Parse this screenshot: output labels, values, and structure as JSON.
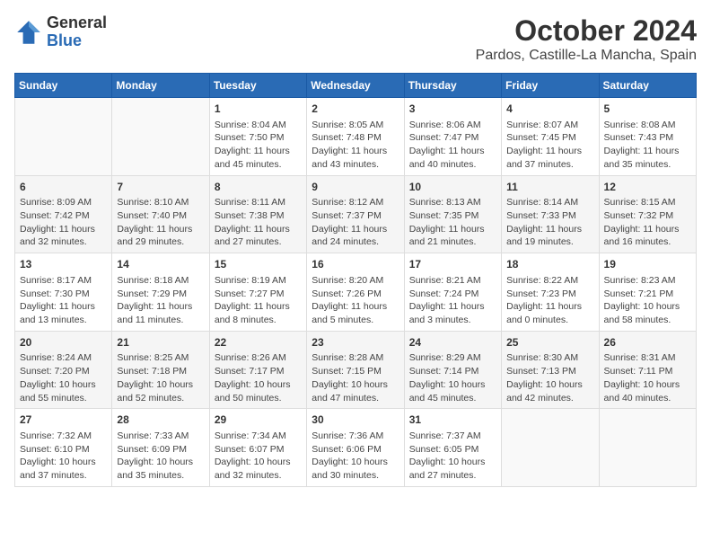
{
  "logo": {
    "general": "General",
    "blue": "Blue"
  },
  "title": "October 2024",
  "subtitle": "Pardos, Castille-La Mancha, Spain",
  "days_of_week": [
    "Sunday",
    "Monday",
    "Tuesday",
    "Wednesday",
    "Thursday",
    "Friday",
    "Saturday"
  ],
  "weeks": [
    [
      {
        "day": "",
        "info": ""
      },
      {
        "day": "",
        "info": ""
      },
      {
        "day": "1",
        "info": "Sunrise: 8:04 AM\nSunset: 7:50 PM\nDaylight: 11 hours and 45 minutes."
      },
      {
        "day": "2",
        "info": "Sunrise: 8:05 AM\nSunset: 7:48 PM\nDaylight: 11 hours and 43 minutes."
      },
      {
        "day": "3",
        "info": "Sunrise: 8:06 AM\nSunset: 7:47 PM\nDaylight: 11 hours and 40 minutes."
      },
      {
        "day": "4",
        "info": "Sunrise: 8:07 AM\nSunset: 7:45 PM\nDaylight: 11 hours and 37 minutes."
      },
      {
        "day": "5",
        "info": "Sunrise: 8:08 AM\nSunset: 7:43 PM\nDaylight: 11 hours and 35 minutes."
      }
    ],
    [
      {
        "day": "6",
        "info": "Sunrise: 8:09 AM\nSunset: 7:42 PM\nDaylight: 11 hours and 32 minutes."
      },
      {
        "day": "7",
        "info": "Sunrise: 8:10 AM\nSunset: 7:40 PM\nDaylight: 11 hours and 29 minutes."
      },
      {
        "day": "8",
        "info": "Sunrise: 8:11 AM\nSunset: 7:38 PM\nDaylight: 11 hours and 27 minutes."
      },
      {
        "day": "9",
        "info": "Sunrise: 8:12 AM\nSunset: 7:37 PM\nDaylight: 11 hours and 24 minutes."
      },
      {
        "day": "10",
        "info": "Sunrise: 8:13 AM\nSunset: 7:35 PM\nDaylight: 11 hours and 21 minutes."
      },
      {
        "day": "11",
        "info": "Sunrise: 8:14 AM\nSunset: 7:33 PM\nDaylight: 11 hours and 19 minutes."
      },
      {
        "day": "12",
        "info": "Sunrise: 8:15 AM\nSunset: 7:32 PM\nDaylight: 11 hours and 16 minutes."
      }
    ],
    [
      {
        "day": "13",
        "info": "Sunrise: 8:17 AM\nSunset: 7:30 PM\nDaylight: 11 hours and 13 minutes."
      },
      {
        "day": "14",
        "info": "Sunrise: 8:18 AM\nSunset: 7:29 PM\nDaylight: 11 hours and 11 minutes."
      },
      {
        "day": "15",
        "info": "Sunrise: 8:19 AM\nSunset: 7:27 PM\nDaylight: 11 hours and 8 minutes."
      },
      {
        "day": "16",
        "info": "Sunrise: 8:20 AM\nSunset: 7:26 PM\nDaylight: 11 hours and 5 minutes."
      },
      {
        "day": "17",
        "info": "Sunrise: 8:21 AM\nSunset: 7:24 PM\nDaylight: 11 hours and 3 minutes."
      },
      {
        "day": "18",
        "info": "Sunrise: 8:22 AM\nSunset: 7:23 PM\nDaylight: 11 hours and 0 minutes."
      },
      {
        "day": "19",
        "info": "Sunrise: 8:23 AM\nSunset: 7:21 PM\nDaylight: 10 hours and 58 minutes."
      }
    ],
    [
      {
        "day": "20",
        "info": "Sunrise: 8:24 AM\nSunset: 7:20 PM\nDaylight: 10 hours and 55 minutes."
      },
      {
        "day": "21",
        "info": "Sunrise: 8:25 AM\nSunset: 7:18 PM\nDaylight: 10 hours and 52 minutes."
      },
      {
        "day": "22",
        "info": "Sunrise: 8:26 AM\nSunset: 7:17 PM\nDaylight: 10 hours and 50 minutes."
      },
      {
        "day": "23",
        "info": "Sunrise: 8:28 AM\nSunset: 7:15 PM\nDaylight: 10 hours and 47 minutes."
      },
      {
        "day": "24",
        "info": "Sunrise: 8:29 AM\nSunset: 7:14 PM\nDaylight: 10 hours and 45 minutes."
      },
      {
        "day": "25",
        "info": "Sunrise: 8:30 AM\nSunset: 7:13 PM\nDaylight: 10 hours and 42 minutes."
      },
      {
        "day": "26",
        "info": "Sunrise: 8:31 AM\nSunset: 7:11 PM\nDaylight: 10 hours and 40 minutes."
      }
    ],
    [
      {
        "day": "27",
        "info": "Sunrise: 7:32 AM\nSunset: 6:10 PM\nDaylight: 10 hours and 37 minutes."
      },
      {
        "day": "28",
        "info": "Sunrise: 7:33 AM\nSunset: 6:09 PM\nDaylight: 10 hours and 35 minutes."
      },
      {
        "day": "29",
        "info": "Sunrise: 7:34 AM\nSunset: 6:07 PM\nDaylight: 10 hours and 32 minutes."
      },
      {
        "day": "30",
        "info": "Sunrise: 7:36 AM\nSunset: 6:06 PM\nDaylight: 10 hours and 30 minutes."
      },
      {
        "day": "31",
        "info": "Sunrise: 7:37 AM\nSunset: 6:05 PM\nDaylight: 10 hours and 27 minutes."
      },
      {
        "day": "",
        "info": ""
      },
      {
        "day": "",
        "info": ""
      }
    ]
  ]
}
